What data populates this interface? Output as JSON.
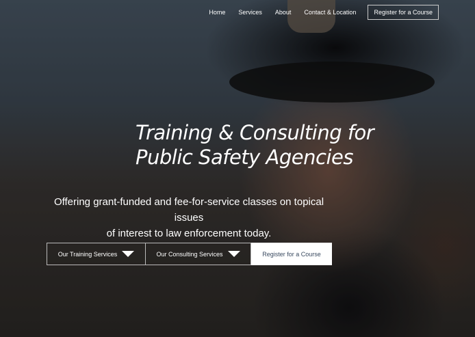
{
  "nav": {
    "items": [
      "Home",
      "Services",
      "About",
      "Contact & Location"
    ],
    "register": "Register for a Course"
  },
  "hero": {
    "title_line1": "Training & Consulting for",
    "title_line2": "Public Safety Agencies",
    "subtitle_line1": "Offering grant-funded and fee-for-service classes on topical issues",
    "subtitle_line2": "of interest to law enforcement today.",
    "buttons": {
      "training": "Our Training Services",
      "consulting": "Our Consulting Services",
      "register": "Register for a Course"
    }
  }
}
